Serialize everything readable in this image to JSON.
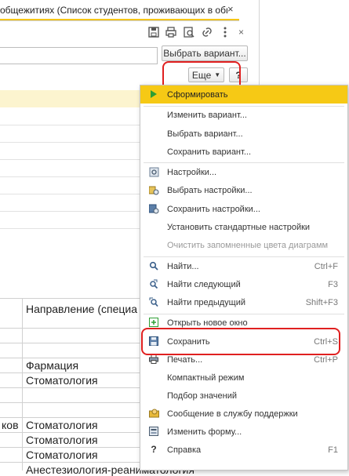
{
  "window": {
    "tab_title": "общежитиях (Список студентов, проживающих в общежитиях)",
    "close_glyph": "×"
  },
  "form": {
    "select_variant_label": "Выбрать вариант...",
    "more_label": "Еще",
    "help_label": "?"
  },
  "report": {
    "column_header": "Направление (специа",
    "rows": [
      {
        "left": "",
        "right": "Фармация"
      },
      {
        "left": "",
        "right": "Стоматология"
      },
      {
        "left": "",
        "right": ""
      },
      {
        "left": "",
        "right": ""
      },
      {
        "left": "ков",
        "right": "Стоматология"
      },
      {
        "left": "",
        "right": "Стоматология"
      },
      {
        "left": "",
        "right": "Стоматология"
      },
      {
        "left": "",
        "right": "Анестезиология-реаниматология"
      }
    ]
  },
  "menu": {
    "items": [
      {
        "label": "Сформировать",
        "shortcut": "",
        "icon": "play-icon",
        "state": "active"
      },
      {
        "label": "Изменить вариант...",
        "shortcut": "",
        "icon": "",
        "state": "normal"
      },
      {
        "label": "Выбрать вариант...",
        "shortcut": "",
        "icon": "",
        "state": "normal"
      },
      {
        "label": "Сохранить вариант...",
        "shortcut": "",
        "icon": "",
        "state": "normal"
      },
      {
        "label": "Настройки...",
        "shortcut": "",
        "icon": "settings-icon",
        "state": "normal"
      },
      {
        "label": "Выбрать настройки...",
        "shortcut": "",
        "icon": "select-settings-icon",
        "state": "normal"
      },
      {
        "label": "Сохранить настройки...",
        "shortcut": "",
        "icon": "save-settings-icon",
        "state": "normal"
      },
      {
        "label": "Установить стандартные настройки",
        "shortcut": "",
        "icon": "",
        "state": "normal"
      },
      {
        "label": "Очистить запомненные цвета диаграмм",
        "shortcut": "",
        "icon": "",
        "state": "disabled"
      },
      {
        "label": "Найти...",
        "shortcut": "Ctrl+F",
        "icon": "find-icon",
        "state": "normal"
      },
      {
        "label": "Найти следующий",
        "shortcut": "F3",
        "icon": "find-next-icon",
        "state": "normal"
      },
      {
        "label": "Найти предыдущий",
        "shortcut": "Shift+F3",
        "icon": "find-previous-icon",
        "state": "normal"
      },
      {
        "label": "Открыть новое окно",
        "shortcut": "",
        "icon": "new-window-icon",
        "state": "normal"
      },
      {
        "label": "Сохранить",
        "shortcut": "Ctrl+S",
        "icon": "floppy-disk-icon",
        "state": "normal"
      },
      {
        "label": "Печать...",
        "shortcut": "Ctrl+P",
        "icon": "printer-icon",
        "state": "normal"
      },
      {
        "label": "Компактный режим",
        "shortcut": "",
        "icon": "",
        "state": "normal"
      },
      {
        "label": "Подбор значений",
        "shortcut": "",
        "icon": "",
        "state": "normal"
      },
      {
        "label": "Сообщение в службу поддержки",
        "shortcut": "",
        "icon": "support-message-icon",
        "state": "normal"
      },
      {
        "label": "Изменить форму...",
        "shortcut": "",
        "icon": "edit-form-icon",
        "state": "normal"
      },
      {
        "label": "Справка",
        "shortcut": "F1",
        "icon": "help-icon",
        "state": "normal"
      }
    ]
  },
  "colors": {
    "accent": "#f6c915",
    "annotation": "#e02020"
  }
}
